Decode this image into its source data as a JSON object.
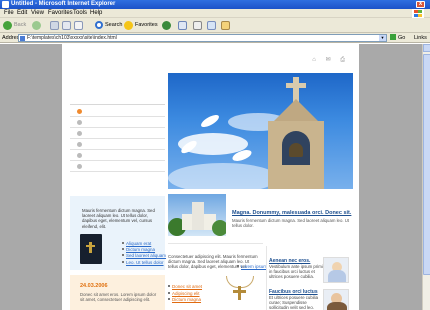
{
  "window": {
    "title": "Untitled - Microsoft Internet Explorer",
    "close_glyph": "x"
  },
  "menu": {
    "items": [
      "File",
      "Edit",
      "View",
      "Favorites",
      "Tools",
      "Help"
    ]
  },
  "toolbar": {
    "back_label": "Back",
    "search_label": "Search",
    "favorites_label": "Favorites",
    "accent": "#ece9d8"
  },
  "address": {
    "label": "Address",
    "url": "F:\\templates\\ch103\\xxxxx\\site\\index.html",
    "go_label": "Go",
    "links_label": "Links"
  },
  "page": {
    "top_icons": "⌂ ✉ ⎙",
    "sermon_text": "Mauris fermentum dictum magna. Sed laoreet aliquam leo. Ut tellus dolor, dapibus eget, elementum vel, cursus eleifend, elit.",
    "sermon_links": [
      "Aliquam erat",
      "Dictum magna",
      "Sed laoreet aliquam",
      "Leo. Ut tellus dolor"
    ],
    "date": "24.03.2006",
    "date_text": "Donec sit amet eros. Lorem ipsum dolor sit amet, consectetuer adipiscing elit.",
    "feature_heading": "Magna. Donummy, malesuada orci. Donec sit.",
    "feature_text": "Mauris fermentum dictum magna. Sed laoreet aliquam leo. Ut tellus dolor.",
    "mid_text": "Consectetuer adipiscing elit. Mauris fermentum dictum magna. Sed laoreet aliquam leo. Ut tellus dolor, dapibus eget, elementum vel.",
    "mid_link": "Lorem ipsum",
    "mid_list": [
      "Donec sit amet",
      "Adipiscing elit",
      "Dictum magna"
    ],
    "right_blocks": [
      {
        "heading": "Aenean nec eros.",
        "text": "Vestibulum ante ipsum primis in faucibus orci luctus et ultrices posuere cubilia."
      },
      {
        "heading": "Faucibus orci luctus",
        "text": "Et ultrices posuere cubilia curae; Suspendisse sollicitudin velit sed leo."
      }
    ]
  }
}
